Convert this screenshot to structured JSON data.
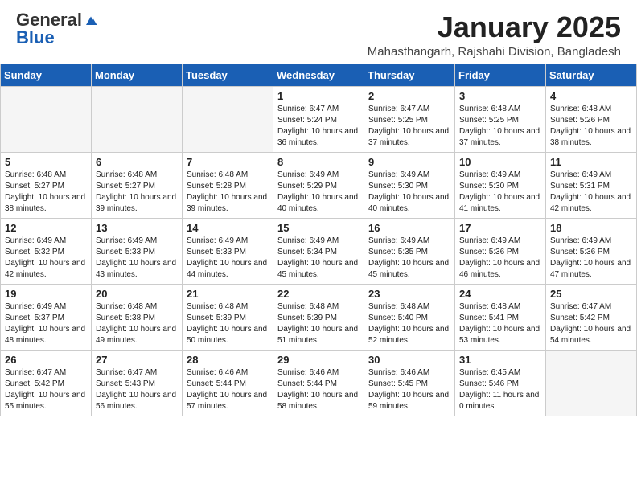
{
  "logo": {
    "general": "General",
    "blue": "Blue"
  },
  "header": {
    "month": "January 2025",
    "location": "Mahasthangarh, Rajshahi Division, Bangladesh"
  },
  "weekdays": [
    "Sunday",
    "Monday",
    "Tuesday",
    "Wednesday",
    "Thursday",
    "Friday",
    "Saturday"
  ],
  "weeks": [
    [
      {
        "day": "",
        "empty": true
      },
      {
        "day": "",
        "empty": true
      },
      {
        "day": "",
        "empty": true
      },
      {
        "day": "1",
        "sunrise": "6:47 AM",
        "sunset": "5:24 PM",
        "daylight": "10 hours and 36 minutes."
      },
      {
        "day": "2",
        "sunrise": "6:47 AM",
        "sunset": "5:25 PM",
        "daylight": "10 hours and 37 minutes."
      },
      {
        "day": "3",
        "sunrise": "6:48 AM",
        "sunset": "5:25 PM",
        "daylight": "10 hours and 37 minutes."
      },
      {
        "day": "4",
        "sunrise": "6:48 AM",
        "sunset": "5:26 PM",
        "daylight": "10 hours and 38 minutes."
      }
    ],
    [
      {
        "day": "5",
        "sunrise": "6:48 AM",
        "sunset": "5:27 PM",
        "daylight": "10 hours and 38 minutes."
      },
      {
        "day": "6",
        "sunrise": "6:48 AM",
        "sunset": "5:27 PM",
        "daylight": "10 hours and 39 minutes."
      },
      {
        "day": "7",
        "sunrise": "6:48 AM",
        "sunset": "5:28 PM",
        "daylight": "10 hours and 39 minutes."
      },
      {
        "day": "8",
        "sunrise": "6:49 AM",
        "sunset": "5:29 PM",
        "daylight": "10 hours and 40 minutes."
      },
      {
        "day": "9",
        "sunrise": "6:49 AM",
        "sunset": "5:30 PM",
        "daylight": "10 hours and 40 minutes."
      },
      {
        "day": "10",
        "sunrise": "6:49 AM",
        "sunset": "5:30 PM",
        "daylight": "10 hours and 41 minutes."
      },
      {
        "day": "11",
        "sunrise": "6:49 AM",
        "sunset": "5:31 PM",
        "daylight": "10 hours and 42 minutes."
      }
    ],
    [
      {
        "day": "12",
        "sunrise": "6:49 AM",
        "sunset": "5:32 PM",
        "daylight": "10 hours and 42 minutes."
      },
      {
        "day": "13",
        "sunrise": "6:49 AM",
        "sunset": "5:33 PM",
        "daylight": "10 hours and 43 minutes."
      },
      {
        "day": "14",
        "sunrise": "6:49 AM",
        "sunset": "5:33 PM",
        "daylight": "10 hours and 44 minutes."
      },
      {
        "day": "15",
        "sunrise": "6:49 AM",
        "sunset": "5:34 PM",
        "daylight": "10 hours and 45 minutes."
      },
      {
        "day": "16",
        "sunrise": "6:49 AM",
        "sunset": "5:35 PM",
        "daylight": "10 hours and 45 minutes."
      },
      {
        "day": "17",
        "sunrise": "6:49 AM",
        "sunset": "5:36 PM",
        "daylight": "10 hours and 46 minutes."
      },
      {
        "day": "18",
        "sunrise": "6:49 AM",
        "sunset": "5:36 PM",
        "daylight": "10 hours and 47 minutes."
      }
    ],
    [
      {
        "day": "19",
        "sunrise": "6:49 AM",
        "sunset": "5:37 PM",
        "daylight": "10 hours and 48 minutes."
      },
      {
        "day": "20",
        "sunrise": "6:48 AM",
        "sunset": "5:38 PM",
        "daylight": "10 hours and 49 minutes."
      },
      {
        "day": "21",
        "sunrise": "6:48 AM",
        "sunset": "5:39 PM",
        "daylight": "10 hours and 50 minutes."
      },
      {
        "day": "22",
        "sunrise": "6:48 AM",
        "sunset": "5:39 PM",
        "daylight": "10 hours and 51 minutes."
      },
      {
        "day": "23",
        "sunrise": "6:48 AM",
        "sunset": "5:40 PM",
        "daylight": "10 hours and 52 minutes."
      },
      {
        "day": "24",
        "sunrise": "6:48 AM",
        "sunset": "5:41 PM",
        "daylight": "10 hours and 53 minutes."
      },
      {
        "day": "25",
        "sunrise": "6:47 AM",
        "sunset": "5:42 PM",
        "daylight": "10 hours and 54 minutes."
      }
    ],
    [
      {
        "day": "26",
        "sunrise": "6:47 AM",
        "sunset": "5:42 PM",
        "daylight": "10 hours and 55 minutes."
      },
      {
        "day": "27",
        "sunrise": "6:47 AM",
        "sunset": "5:43 PM",
        "daylight": "10 hours and 56 minutes."
      },
      {
        "day": "28",
        "sunrise": "6:46 AM",
        "sunset": "5:44 PM",
        "daylight": "10 hours and 57 minutes."
      },
      {
        "day": "29",
        "sunrise": "6:46 AM",
        "sunset": "5:44 PM",
        "daylight": "10 hours and 58 minutes."
      },
      {
        "day": "30",
        "sunrise": "6:46 AM",
        "sunset": "5:45 PM",
        "daylight": "10 hours and 59 minutes."
      },
      {
        "day": "31",
        "sunrise": "6:45 AM",
        "sunset": "5:46 PM",
        "daylight": "11 hours and 0 minutes."
      },
      {
        "day": "",
        "empty": true
      }
    ]
  ],
  "labels": {
    "sunrise": "Sunrise:",
    "sunset": "Sunset:",
    "daylight": "Daylight:"
  }
}
